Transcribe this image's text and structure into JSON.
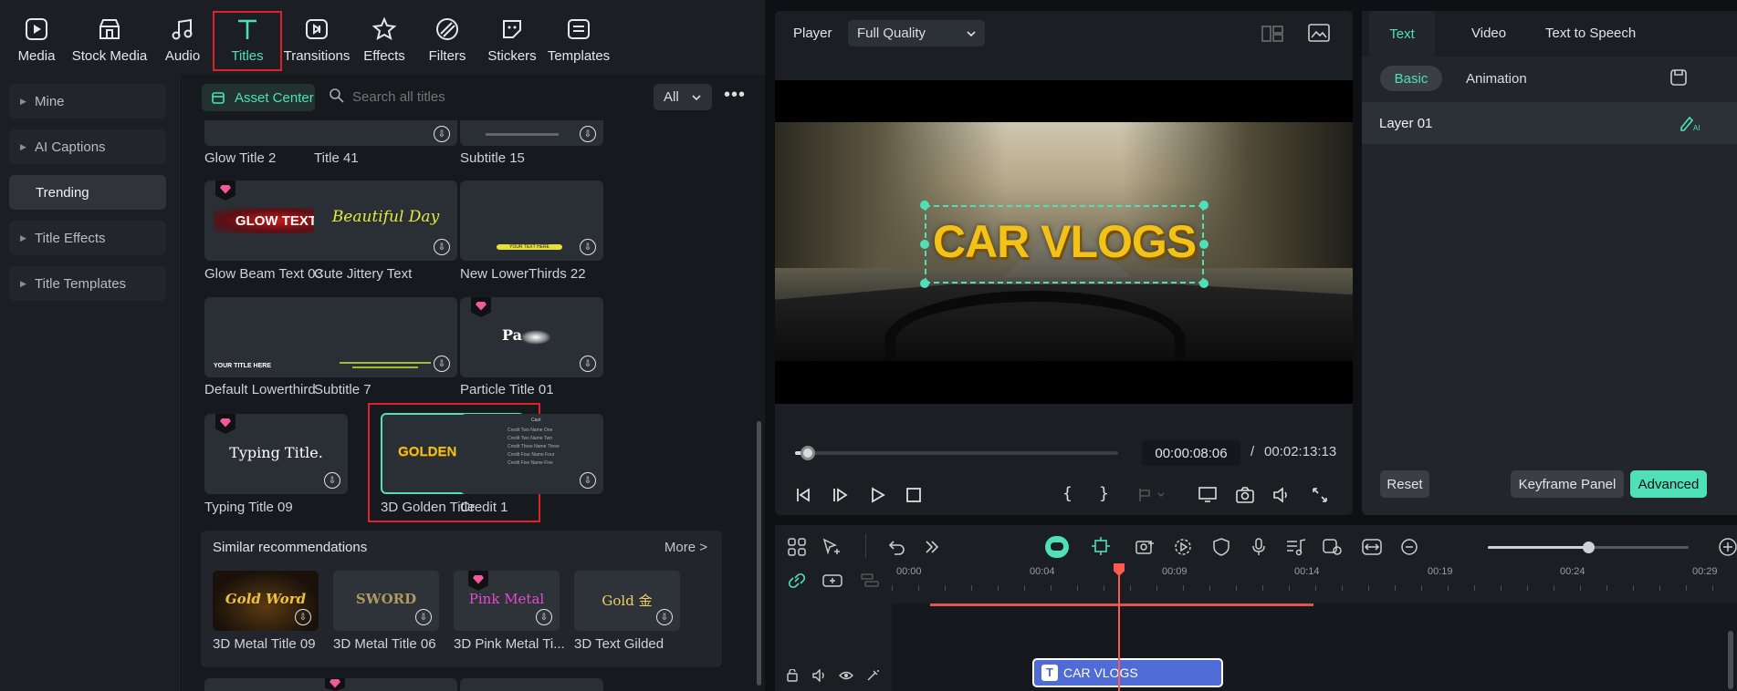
{
  "toolbar": {
    "tabs": [
      {
        "label": "Media",
        "icon": "media-icon"
      },
      {
        "label": "Stock Media",
        "icon": "stock-media-icon"
      },
      {
        "label": "Audio",
        "icon": "audio-icon"
      },
      {
        "label": "Titles",
        "icon": "titles-icon"
      },
      {
        "label": "Transitions",
        "icon": "transitions-icon"
      },
      {
        "label": "Effects",
        "icon": "effects-icon"
      },
      {
        "label": "Filters",
        "icon": "filters-icon"
      },
      {
        "label": "Stickers",
        "icon": "stickers-icon"
      },
      {
        "label": "Templates",
        "icon": "templates-icon"
      }
    ],
    "active": "Titles"
  },
  "sidebar": {
    "items": [
      {
        "label": "Mine"
      },
      {
        "label": "AI Captions"
      },
      {
        "label": "Trending"
      },
      {
        "label": "Title Effects"
      },
      {
        "label": "Title Templates"
      }
    ]
  },
  "search": {
    "asset_center": "Asset Center",
    "placeholder": "Search all titles",
    "filter": "All"
  },
  "titles": {
    "row0": [
      "Glow Title 2",
      "Title 41",
      "Subtitle 15"
    ],
    "row1": [
      "Glow Beam Text 03",
      "Cute Jittery Text",
      "New LowerThirds 22"
    ],
    "row2": [
      "Default Lowerthird",
      "Subtitle 7",
      "Particle Title 01"
    ],
    "row3": [
      "Typing Title 09",
      "3D Golden Title",
      "Credit 1"
    ],
    "thumb_text": {
      "glow": "GLOW TEXT",
      "beautiful": "Beautiful Day",
      "lower": "YOUR TEXT HERE",
      "default_lower": "YOUR TITLE HERE",
      "particle": "Pa",
      "typing": "Typing Title.",
      "golden": "GOLDEN YEARS",
      "credit_head": "Cast",
      "credit_lines": [
        "Credit Two   Name One",
        "Credit Two   Name Two",
        "Credit Three   Name Three",
        "Credit Four   Name Four",
        "Credit Five   Name Five"
      ]
    }
  },
  "recommend": {
    "title": "Similar recommendations",
    "more": "More >",
    "items": [
      {
        "label": "3D Metal Title 09",
        "thumb": "Gold Word"
      },
      {
        "label": "3D Metal Title 06",
        "thumb": "SWORD"
      },
      {
        "label": "3D Pink Metal Ti...",
        "thumb": "Pink Metal"
      },
      {
        "label": "3D Text Gilded",
        "thumb": "Gold 金"
      }
    ]
  },
  "player": {
    "label": "Player",
    "quality": "Full Quality",
    "overlay_text": "CAR VLOGS",
    "current_time": "00:00:08:06",
    "separator": "/",
    "total_time": "00:02:13:13",
    "progress": 0.04
  },
  "props": {
    "tabs": [
      "Text",
      "Video",
      "Text to Speech"
    ],
    "subtabs": [
      "Basic",
      "Animation"
    ],
    "layer": "Layer 01",
    "reset": "Reset",
    "keyframe": "Keyframe Panel",
    "advanced": "Advanced"
  },
  "timeline": {
    "ruler": [
      "00:00",
      "00:04",
      "00:09",
      "00:14",
      "00:19",
      "00:24",
      "00:29"
    ],
    "clip_label": "CAR VLOGS",
    "zoom": 0.5
  },
  "colors": {
    "accent": "#4fe0b8",
    "highlight": "#e0212a",
    "clip": "#4f6bd6"
  }
}
